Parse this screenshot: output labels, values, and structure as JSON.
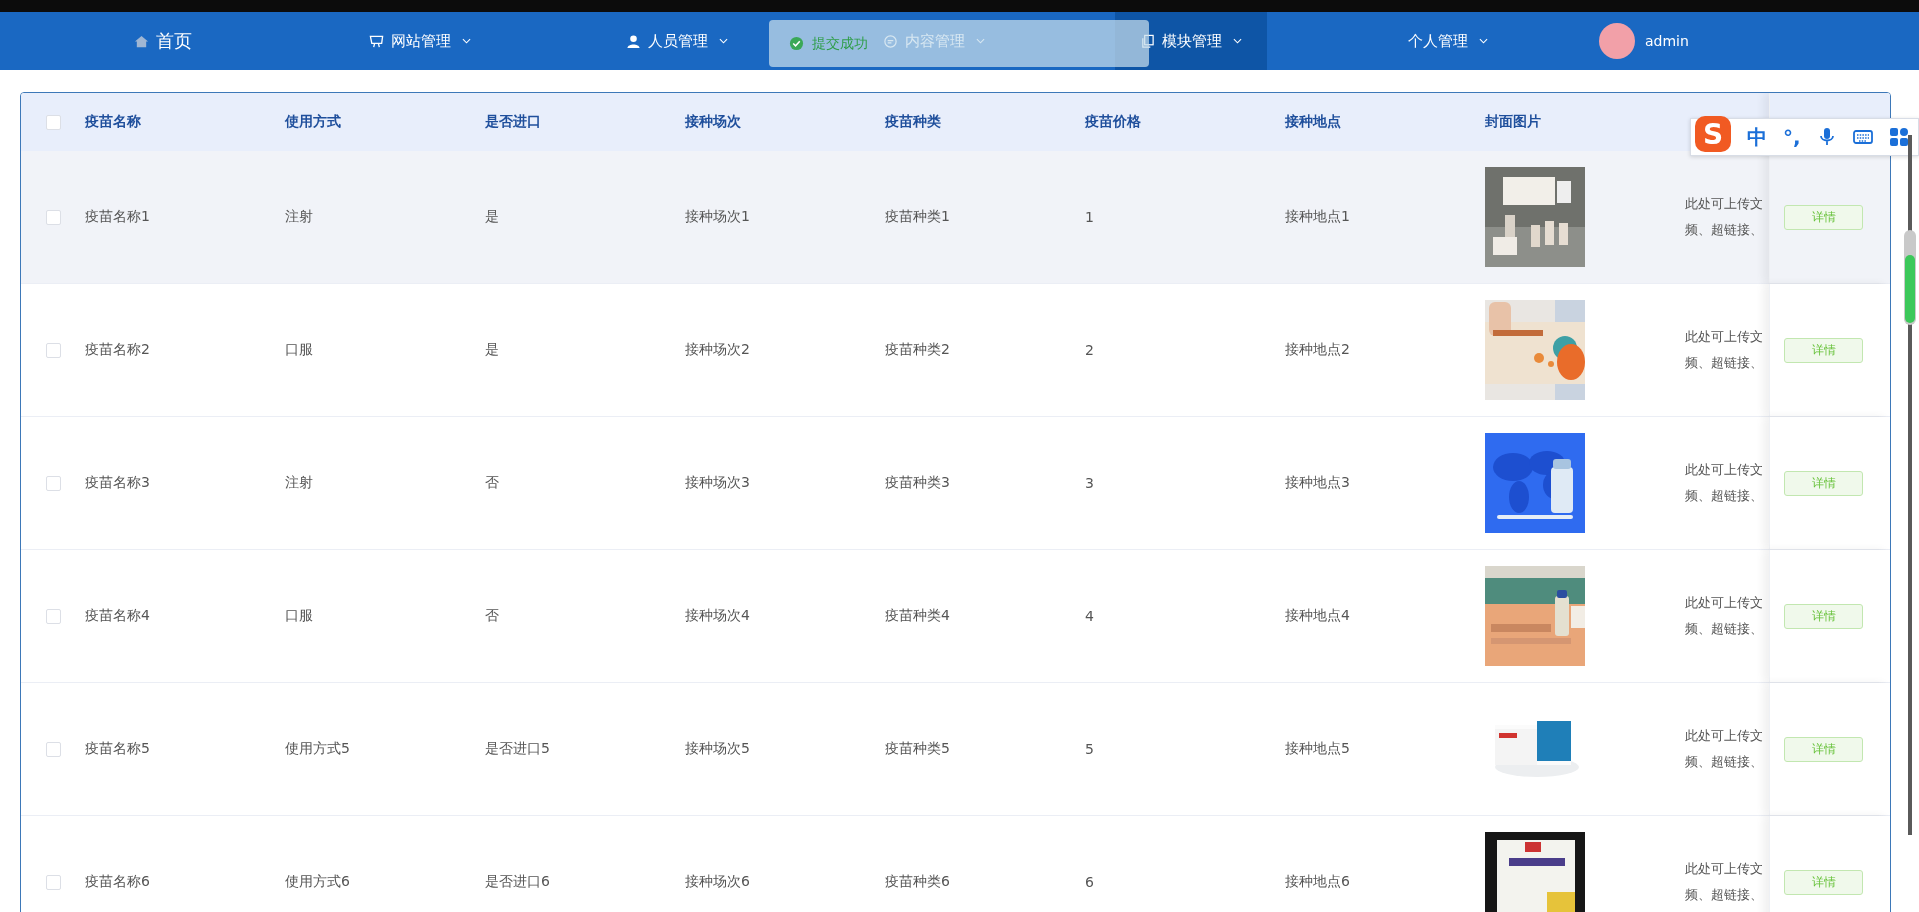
{
  "nav": {
    "items": [
      {
        "label": "首页",
        "dropdown": false,
        "selected": false
      },
      {
        "label": "网站管理",
        "dropdown": true,
        "selected": false
      },
      {
        "label": "人员管理",
        "dropdown": true,
        "selected": false
      },
      {
        "label": "内容管理",
        "dropdown": true,
        "selected": false
      },
      {
        "label": "模块管理",
        "dropdown": true,
        "selected": true
      },
      {
        "label": "个人管理",
        "dropdown": true,
        "selected": false
      }
    ]
  },
  "user": {
    "name": "admin"
  },
  "toast": {
    "message": "提交成功"
  },
  "table": {
    "header_checkbox": {
      "checked": false
    },
    "columns": [
      "疫苗名称",
      "使用方式",
      "是否进口",
      "接种场次",
      "疫苗种类",
      "疫苗价格",
      "接种地点",
      "封面图片"
    ],
    "rows": [
      {
        "checked": false,
        "highlighted": true,
        "cells": [
          "疫苗名称1",
          "注射",
          "是",
          "接种场次1",
          "疫苗种类1",
          "1",
          "接种地点1"
        ],
        "cover": {
          "kind": "picture"
        },
        "preview": [
          "此处可上传文",
          "频、超链接、"
        ],
        "action": "详情"
      },
      {
        "checked": false,
        "highlighted": false,
        "cells": [
          "疫苗名称2",
          "口服",
          "是",
          "接种场次2",
          "疫苗种类2",
          "2",
          "接种地点2"
        ],
        "cover": {
          "kind": "picture"
        },
        "preview": [
          "此处可上传文",
          "频、超链接、"
        ],
        "action": "详情"
      },
      {
        "checked": false,
        "highlighted": false,
        "cells": [
          "疫苗名称3",
          "注射",
          "否",
          "接种场次3",
          "疫苗种类3",
          "3",
          "接种地点3"
        ],
        "cover": {
          "kind": "picture"
        },
        "preview": [
          "此处可上传文",
          "频、超链接、"
        ],
        "action": "详情"
      },
      {
        "checked": false,
        "highlighted": false,
        "cells": [
          "疫苗名称4",
          "口服",
          "否",
          "接种场次4",
          "疫苗种类4",
          "4",
          "接种地点4"
        ],
        "cover": {
          "kind": "picture"
        },
        "preview": [
          "此处可上传文",
          "频、超链接、"
        ],
        "action": "详情"
      },
      {
        "checked": false,
        "highlighted": false,
        "cells": [
          "疫苗名称5",
          "使用方式5",
          "是否进口5",
          "接种场次5",
          "疫苗种类5",
          "5",
          "接种地点5"
        ],
        "cover": {
          "kind": "picture"
        },
        "preview": [
          "此处可上传文",
          "频、超链接、"
        ],
        "action": "详情"
      },
      {
        "checked": false,
        "highlighted": false,
        "cells": [
          "疫苗名称6",
          "使用方式6",
          "是否进口6",
          "接种场次6",
          "疫苗种类6",
          "6",
          "接种地点6"
        ],
        "cover": {
          "kind": "picture"
        },
        "preview": [
          "此处可上传文",
          "频、超链接、"
        ],
        "action": "详情"
      }
    ]
  },
  "ime_bar": {
    "logo": "S",
    "items": [
      "中",
      "°,"
    ]
  }
}
